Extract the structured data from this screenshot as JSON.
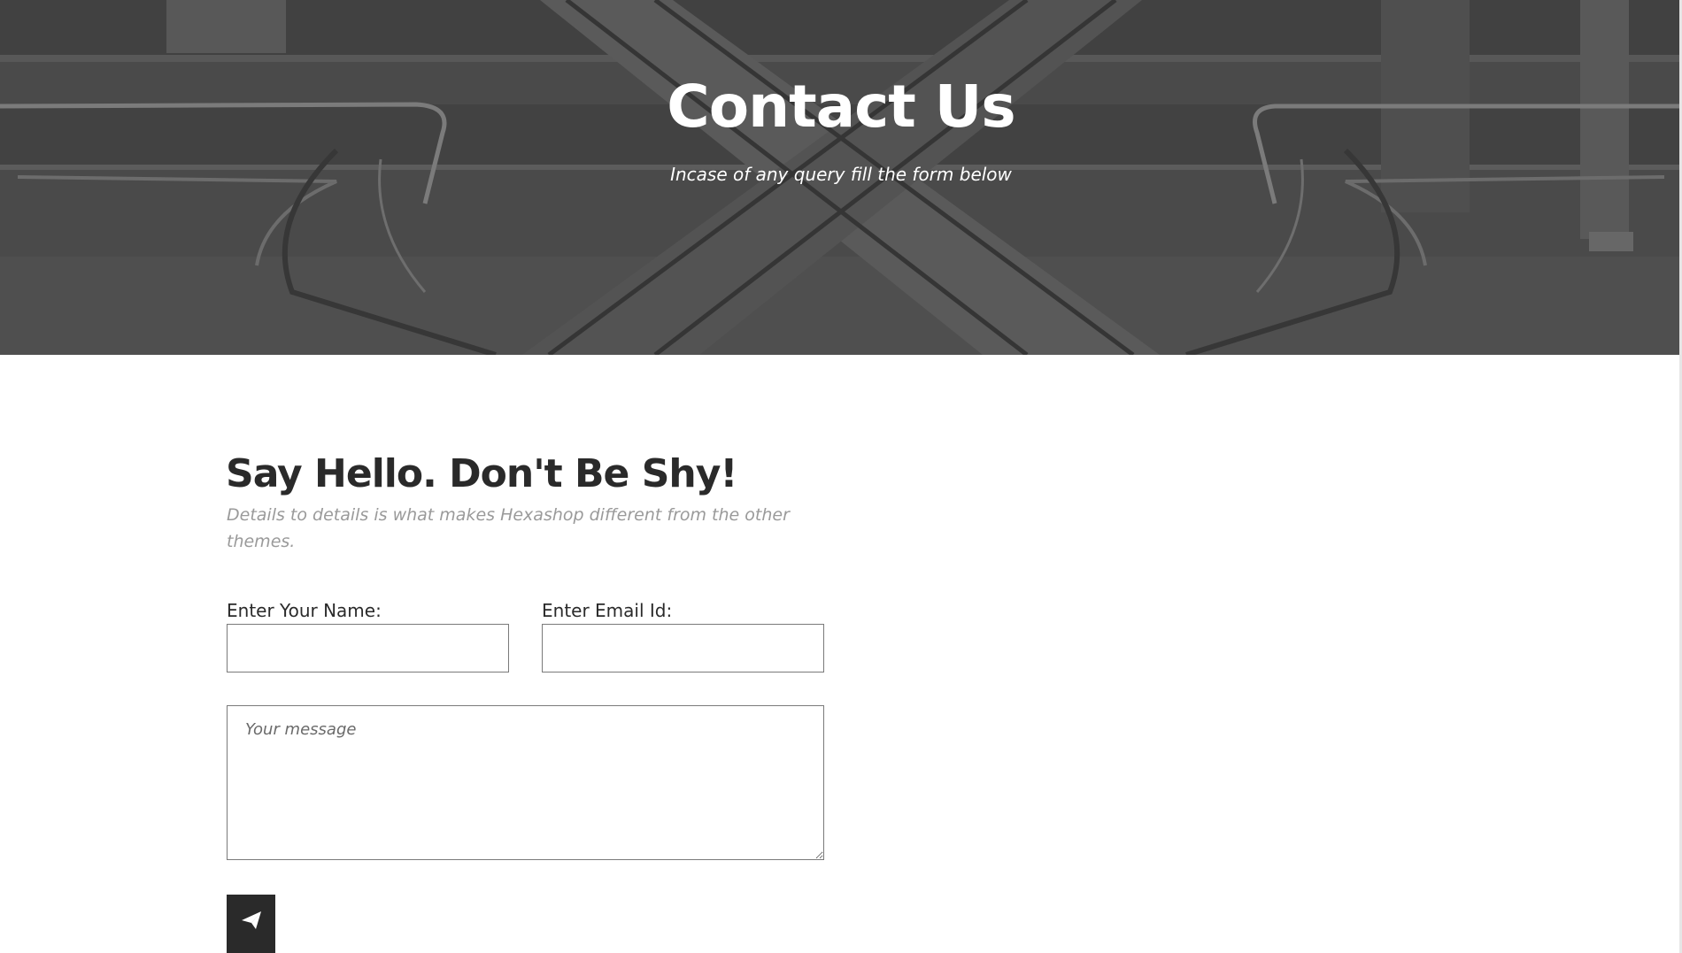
{
  "hero": {
    "title": "Contact Us",
    "subtitle": "Incase of any query fill the form below",
    "background_tone": "#545454",
    "background_image": "escalators-in-shopping-mall-photo"
  },
  "contact": {
    "heading": "Say Hello. Don't Be Shy!",
    "lead": "Details to details is what makes Hexashop different from the other themes.",
    "name_label": "Enter Your Name:",
    "name_value": "",
    "email_label": "Enter Email Id:",
    "email_value": "",
    "message_placeholder": "Your message",
    "message_value": "",
    "submit_icon": "paper-plane-icon"
  },
  "colors": {
    "text_dark": "#2a2a2a",
    "text_muted": "#9a9a9a",
    "border": "#7a7a7a",
    "button_bg": "#2a2a2a",
    "hero_text": "#ffffff"
  }
}
